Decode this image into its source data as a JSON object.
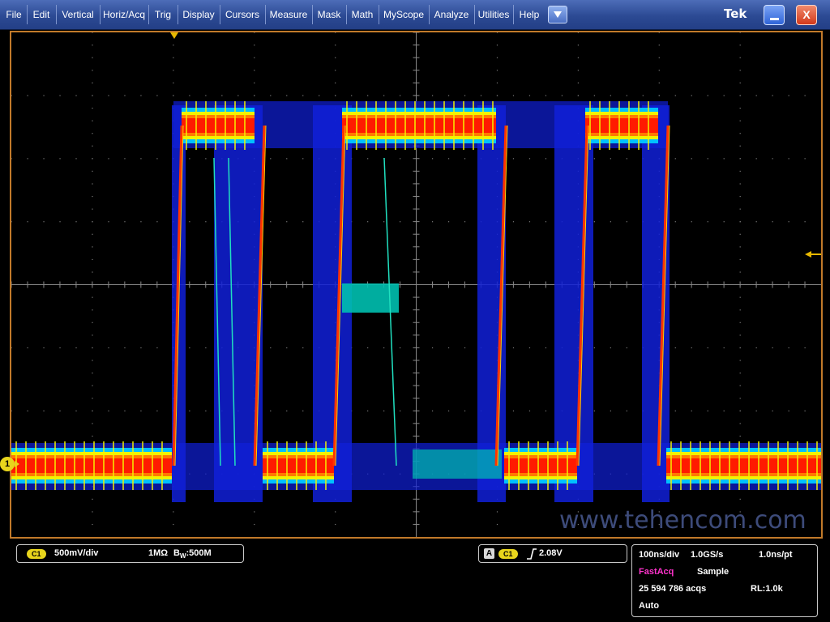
{
  "menu": {
    "items": [
      "File",
      "Edit",
      "Vertical",
      "Horiz/Acq",
      "Trig",
      "Display",
      "Cursors",
      "Measure",
      "Mask",
      "Math",
      "MyScope",
      "Analyze",
      "Utilities",
      "Help"
    ],
    "brand": "Tek",
    "close_label": "X"
  },
  "watermark": "www.tehencom.com",
  "channel1": {
    "marker": "1",
    "pill": "C1",
    "scale": "500mV/div",
    "coupling": "1MΩ",
    "bandwidth_prefix": "B",
    "bandwidth_sub": "W",
    "bandwidth": ":500M"
  },
  "trigger": {
    "mode": "A",
    "pill": "C1",
    "level": "2.08V"
  },
  "acquisition": {
    "timebase": "100ns/div",
    "sample_rate": "1.0GS/s",
    "resolution": "1.0ns/pt",
    "mode": "FastAcq",
    "mode_color": "#ff33cc",
    "sampling": "Sample",
    "count": "25 594 786 acqs",
    "record_length": "RL:1.0k",
    "trigger_state": "Auto"
  },
  "colors": {
    "grid": "#7a7a7a",
    "frame": "#c27a2a",
    "trigger_marker": "#e8b800",
    "channel": "#e8d51c"
  }
}
